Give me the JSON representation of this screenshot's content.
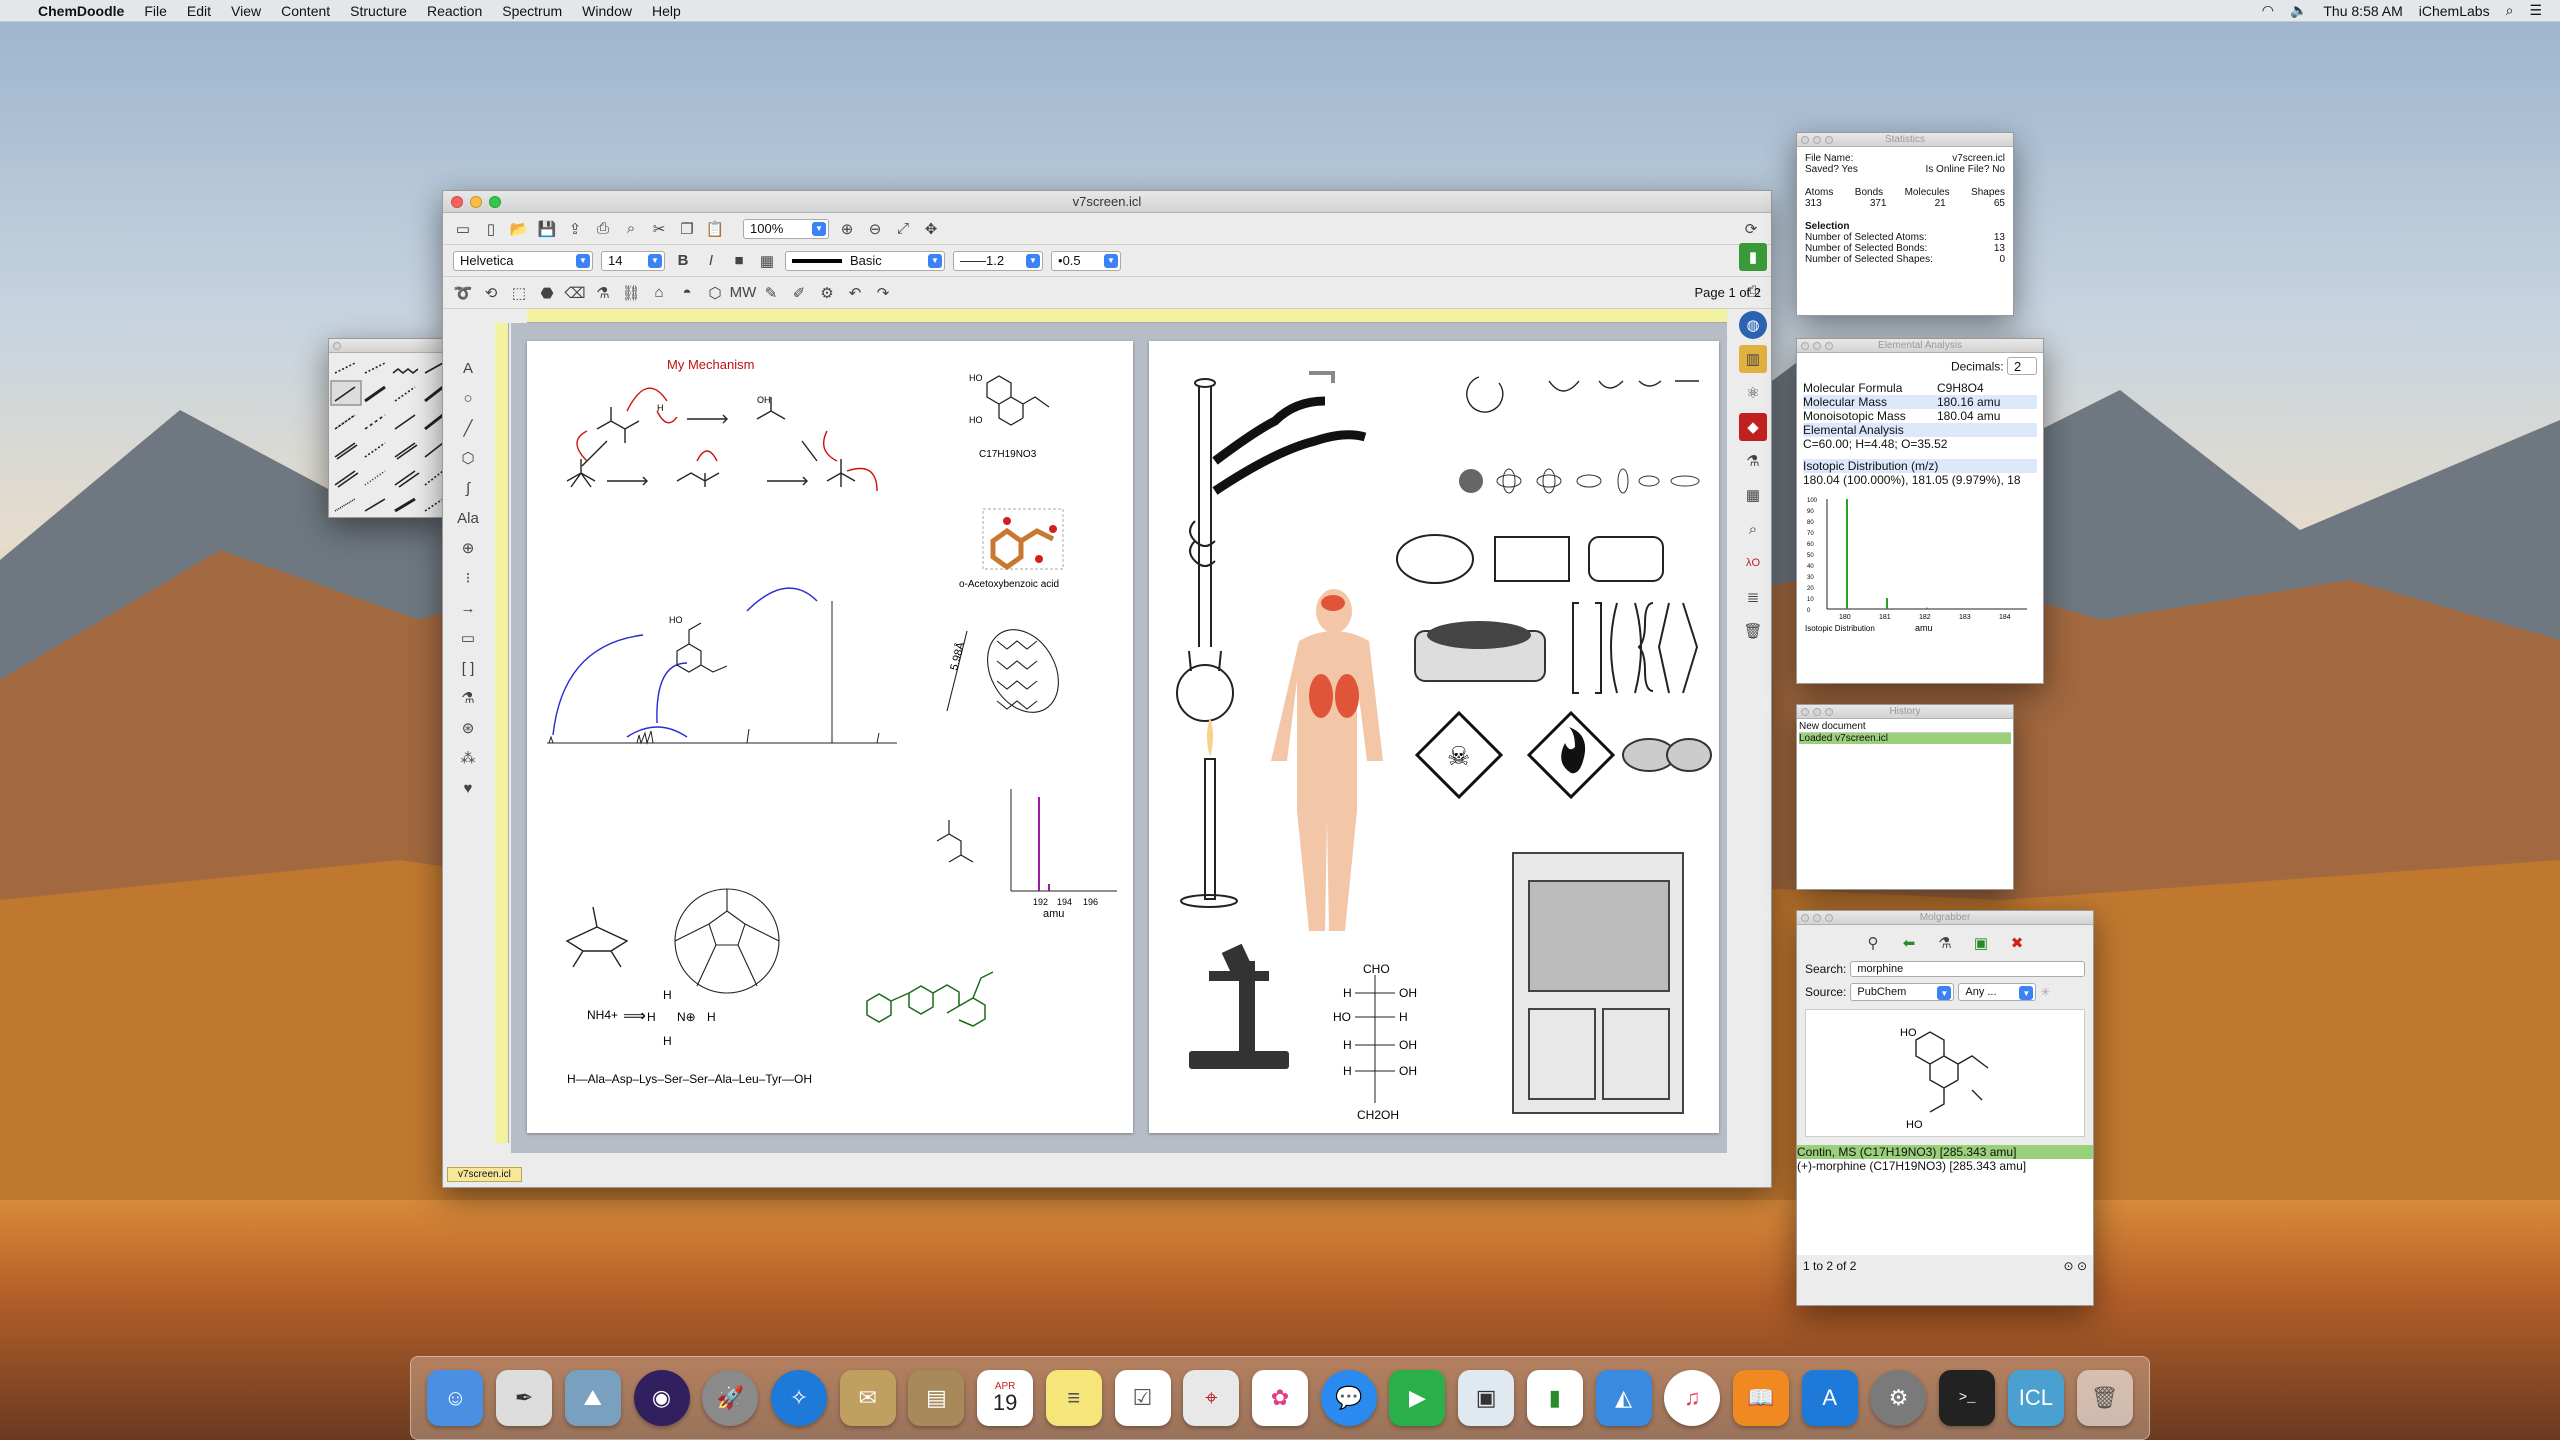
{
  "menubar": {
    "app_name": "ChemDoodle",
    "menus": [
      "File",
      "Edit",
      "View",
      "Content",
      "Structure",
      "Reaction",
      "Spectrum",
      "Window",
      "Help"
    ],
    "clock": "Thu 8:58 AM",
    "user": "iChemLabs"
  },
  "main_window": {
    "title": "v7screen.icl",
    "zoom": "100%",
    "font_family": "Helvetica",
    "font_size": "14",
    "bold_label": "B",
    "italic_label": "I",
    "line_style": "Basic",
    "line_width": "1.2",
    "dot_size": "0.5",
    "page_indicator": "Page 1 of 2",
    "tab_name": "v7screen.icl"
  },
  "page1": {
    "mechanism_title": "My Mechanism",
    "formula_c17": "C17H19NO3",
    "acetoxy_name": "o-Acetoxybenzoic acid",
    "distance_label": "5.98Å",
    "spectrum_ticks": [
      "192",
      "194",
      "196"
    ],
    "spectrum_xlabel": "amu",
    "nh4_label": "NH4+",
    "lewis_h": "H",
    "lewis_n": "N⊕",
    "peptide": "H—Ala–Asp–Lys–Ser–Ser–Ala–Leu–Tyr—OH",
    "fischer": [
      "CHO",
      "H",
      "OH",
      "HO",
      "H",
      "H",
      "OH",
      "H",
      "OH",
      "CH2OH"
    ]
  },
  "statistics": {
    "title": "Statistics",
    "file_name_label": "File Name:",
    "file_name_value": "v7screen.icl",
    "saved_label": "Saved?",
    "saved_value": "Yes",
    "online_label": "Is Online File?",
    "online_value": "No",
    "headers": [
      "Atoms",
      "Bonds",
      "Molecules",
      "Shapes"
    ],
    "values": [
      "313",
      "371",
      "21",
      "65"
    ],
    "selection_label": "Selection",
    "sel_atoms_label": "Number of Selected Atoms:",
    "sel_atoms": "13",
    "sel_bonds_label": "Number of Selected Bonds:",
    "sel_bonds": "13",
    "sel_shapes_label": "Number of Selected Shapes:",
    "sel_shapes": "0"
  },
  "elemental": {
    "title": "Elemental Analysis",
    "decimals_label": "Decimals:",
    "decimals_value": "2",
    "formula_label": "Molecular Formula",
    "formula_value": "C9H8O4",
    "mass_label": "Molecular Mass",
    "mass_value": "180.16 amu",
    "mono_label": "Monoisotopic Mass",
    "mono_value": "180.04 amu",
    "ea_label": "Elemental Analysis",
    "ea_value": "C=60.00; H=4.48; O=35.52",
    "iso_label": "Isotopic Distribution (m/z)",
    "iso_value": "180.04 (100.000%), 181.05 (9.979%), 18",
    "chart_ticks_x": [
      "180",
      "181",
      "182",
      "183",
      "184"
    ],
    "chart_ticks_y": [
      "100",
      "90",
      "80",
      "70",
      "60",
      "50",
      "40",
      "30",
      "20",
      "10",
      "0"
    ],
    "chart_caption": "Isotopic Distribution",
    "chart_unit": "amu"
  },
  "history": {
    "title": "History",
    "items": [
      "New document",
      "Loaded v7screen.icl"
    ]
  },
  "molgrabber": {
    "title": "Molgrabber",
    "search_label": "Search:",
    "search_value": "morphine",
    "source_label": "Source:",
    "source_value": "PubChem",
    "any_value": "Any ...",
    "result1": "Contin, MS (C17H19NO3) [285.343 amu]",
    "result2": "(+)-morphine (C17H19NO3) [285.343 amu]",
    "pager": "1 to 2 of 2"
  },
  "chart_data": {
    "type": "bar",
    "title": "",
    "xlabel": "amu",
    "ylabel": "",
    "categories": [
      "180",
      "181",
      "182",
      "183",
      "184"
    ],
    "values": [
      100,
      9.979,
      1.2,
      0,
      0
    ],
    "xlim": [
      179.5,
      184.5
    ],
    "ylim": [
      0,
      100
    ],
    "colors": {
      "bar": "#2aa02a"
    }
  },
  "dock": {
    "calendar_month": "APR",
    "calendar_day": "19"
  }
}
